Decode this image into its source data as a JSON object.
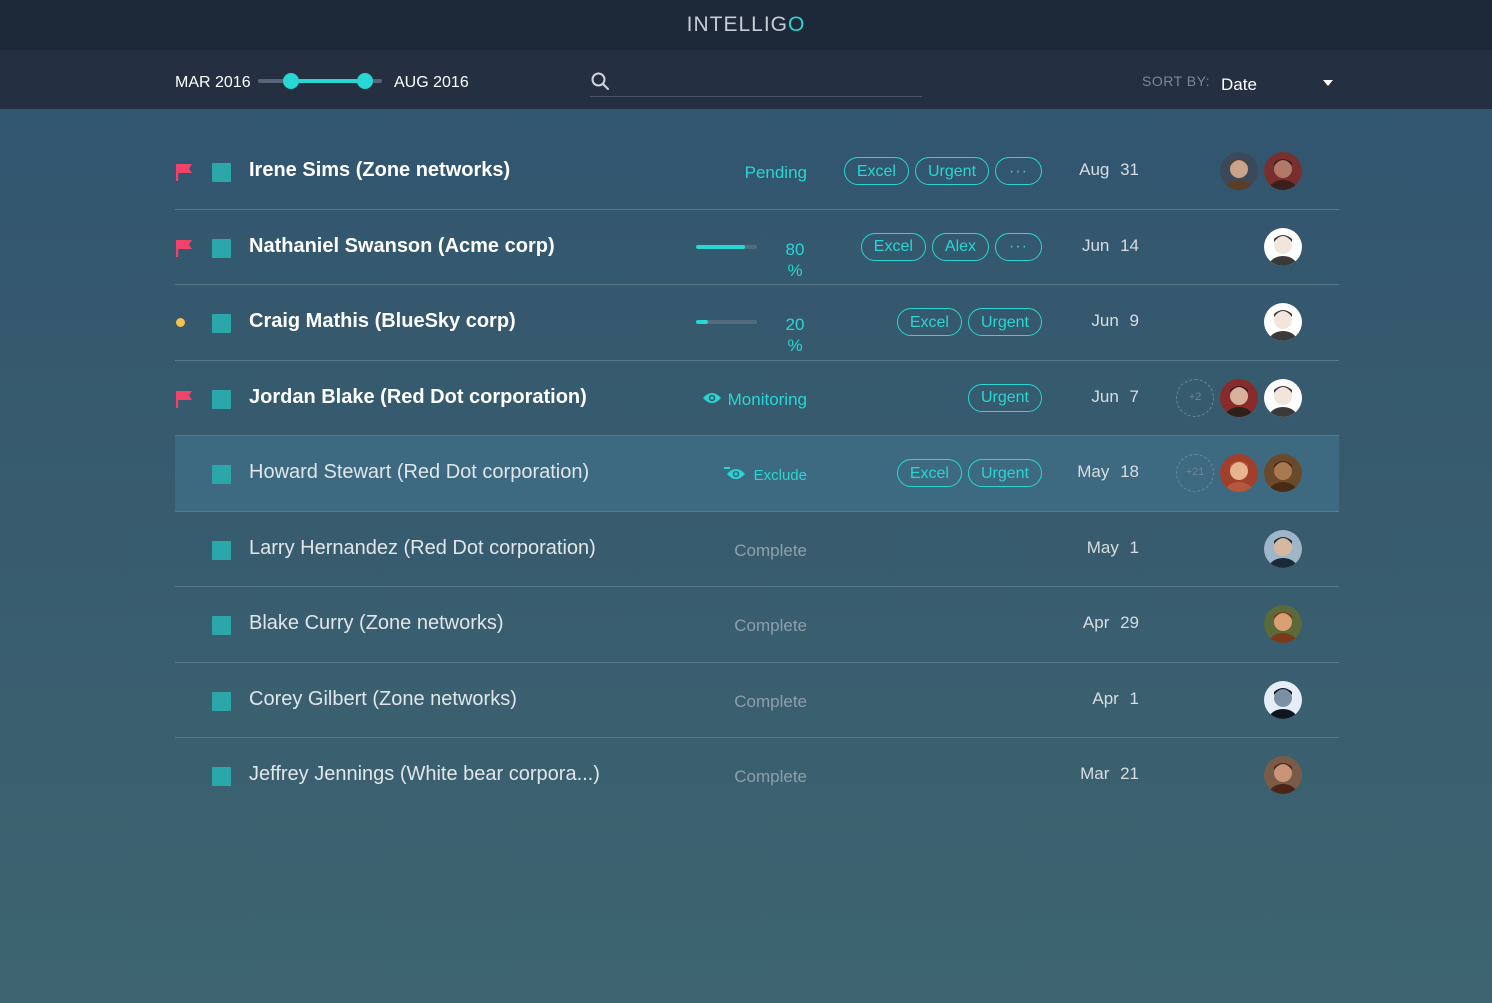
{
  "app": {
    "title_prefix": "INTELLIG",
    "title_accent": "O"
  },
  "toolbar": {
    "range_start": "MAR 2016",
    "range_end": "AUG 2016",
    "range_slider": {
      "low": 0.27,
      "high": 0.86
    },
    "search": {
      "icon": "search-icon",
      "value": "",
      "placeholder": ""
    },
    "sort_label": "SORT BY:",
    "sort_value": "Date"
  },
  "colors": {
    "accent": "#28d7d3",
    "flag": "#f0436b",
    "dot": "#f4c24e",
    "checkbox": "#2ba7aa",
    "header_bg": "#1d2839"
  },
  "rows": [
    {
      "name": "Irene Sims (Zone networks)",
      "marker": "flag",
      "status": "Pending",
      "tags": [
        "Excel",
        "Urgent",
        "···"
      ],
      "date": "Aug 31",
      "avatars": [
        "person-1",
        "person-2"
      ]
    },
    {
      "name": "Nathaniel Swanson (Acme corp)",
      "marker": "flag",
      "progress_value": "80",
      "progress_unit": "%",
      "tags": [
        "Excel",
        "Alex",
        "···"
      ],
      "date": "Jun 14",
      "avatars": [
        "person-3"
      ]
    },
    {
      "name": "Craig Mathis (BlueSky corp)",
      "marker": "dot",
      "progress_value": "20",
      "progress_unit": "%",
      "tags": [
        "Excel",
        "Urgent"
      ],
      "date": "Jun 9",
      "avatars": [
        "person-3"
      ]
    },
    {
      "name": "Jordan Blake (Red Dot corporation)",
      "marker": "flag",
      "status": "Monitoring",
      "tags": [
        "Urgent"
      ],
      "date": "Jun 7",
      "extra_count": "+2",
      "avatars": [
        "person-4",
        "person-3"
      ]
    },
    {
      "name": "Howard Stewart (Red Dot corporation)",
      "status": "Exclude",
      "tags": [
        "Excel",
        "Urgent"
      ],
      "date": "May 18",
      "extra_count": "+21",
      "avatars": [
        "person-5",
        "person-6"
      ]
    },
    {
      "name": "Larry Hernandez (Red Dot corporation)",
      "status": "Complete",
      "date": "May 1",
      "avatars": [
        "person-7"
      ]
    },
    {
      "name": "Blake Curry (Zone networks)",
      "status": "Complete",
      "date": "Apr 29",
      "avatars": [
        "person-8"
      ]
    },
    {
      "name": "Corey Gilbert  (Zone networks)",
      "status": "Complete",
      "date": "Apr 1",
      "avatars": [
        "person-9"
      ]
    },
    {
      "name": "Jeffrey Jennings (White bear corpora...)",
      "status": "Complete",
      "date": "Mar 21",
      "avatars": [
        "person-10"
      ]
    }
  ]
}
